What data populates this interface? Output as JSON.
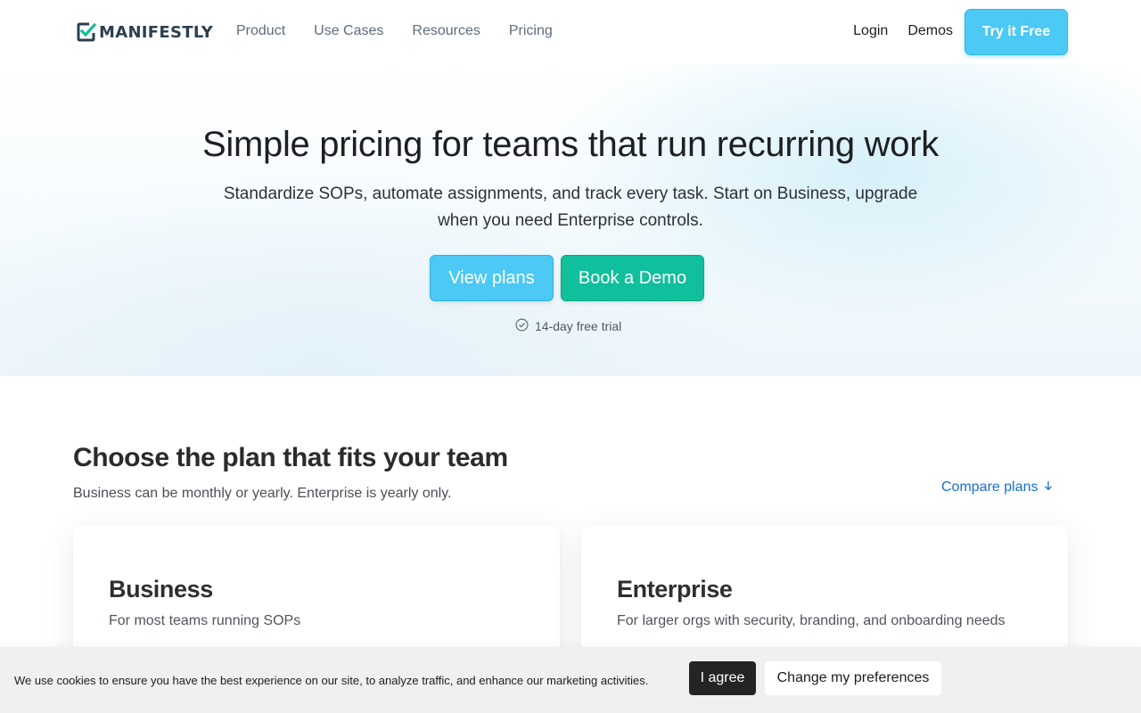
{
  "brand": {
    "name": "MANIFESTLY",
    "logo_icon": "checkbox-check-icon",
    "accent": "#4cc9f5",
    "green": "#10bf9b",
    "link": "#1a6fcf"
  },
  "nav": {
    "primary": [
      "Product",
      "Use Cases",
      "Resources",
      "Pricing"
    ],
    "login": "Login",
    "demos": "Demos",
    "cta": "Try it Free"
  },
  "hero": {
    "title": "Simple pricing for teams that run recurring work",
    "subtitle": "Standardize SOPs, automate assignments, and track every task. Start on Business, upgrade when you need Enterprise controls.",
    "view_plans": "View plans",
    "book_demo": "Book a Demo",
    "trial_icon": "check-circle-icon",
    "trial": "14-day free trial"
  },
  "plans": {
    "title": "Choose the plan that fits your team",
    "subtitle": "Business can be monthly or yearly. Enterprise is yearly only.",
    "compare": "Compare plans",
    "compare_icon": "arrow-down-icon",
    "cards": [
      {
        "name": "Business",
        "desc": "For most teams running SOPs"
      },
      {
        "name": "Enterprise",
        "desc": "For larger orgs with security, branding, and onboarding needs"
      }
    ]
  },
  "cookie": {
    "text": "We use cookies to ensure you have the best experience on our site, to analyze traffic, and enhance our marketing activities.",
    "agree": "I agree",
    "preferences": "Change my preferences"
  }
}
